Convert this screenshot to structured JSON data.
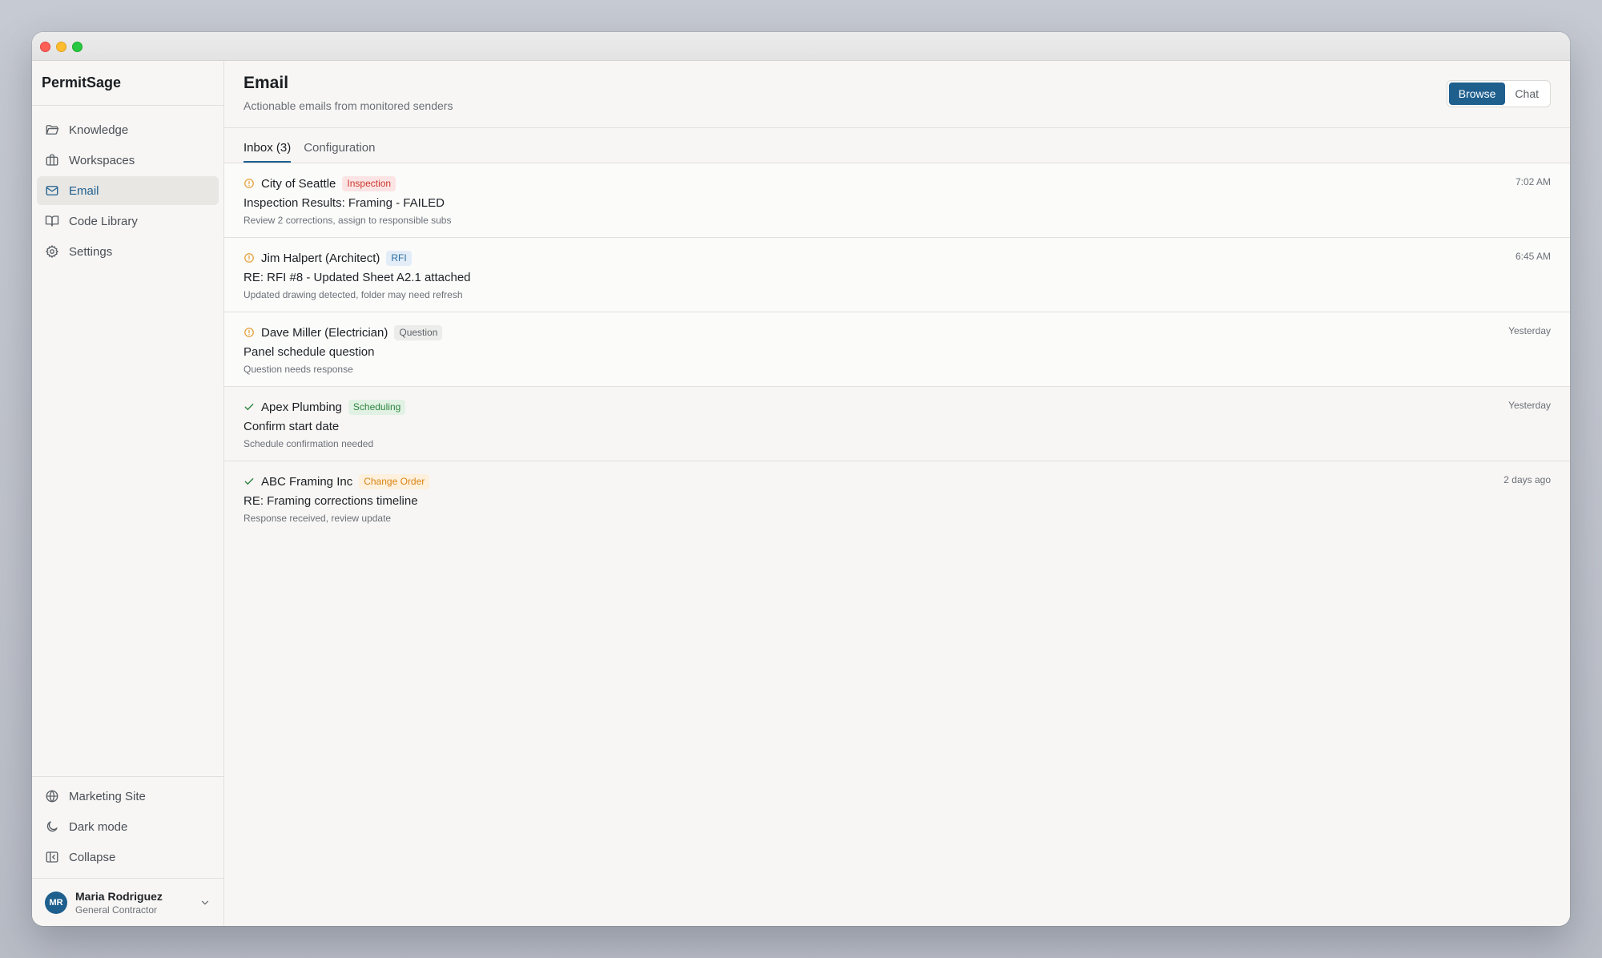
{
  "app": {
    "name": "PermitSage"
  },
  "sidebar": {
    "items": [
      {
        "label": "Knowledge",
        "icon": "folder-icon"
      },
      {
        "label": "Workspaces",
        "icon": "briefcase-icon"
      },
      {
        "label": "Email",
        "icon": "mail-icon",
        "active": true
      },
      {
        "label": "Code Library",
        "icon": "book-icon"
      },
      {
        "label": "Settings",
        "icon": "gear-icon"
      }
    ],
    "bottom_items": [
      {
        "label": "Marketing Site",
        "icon": "globe-icon"
      },
      {
        "label": "Dark mode",
        "icon": "moon-icon"
      },
      {
        "label": "Collapse",
        "icon": "collapse-icon"
      }
    ],
    "user": {
      "initials": "MR",
      "name": "Maria Rodriguez",
      "role": "General Contractor"
    }
  },
  "header": {
    "title": "Email",
    "subtitle": "Actionable emails from monitored senders",
    "view_toggle": {
      "browse": "Browse",
      "chat": "Chat",
      "selected": "Browse"
    }
  },
  "tabs": [
    {
      "label": "Inbox (3)",
      "active": true
    },
    {
      "label": "Configuration",
      "active": false
    }
  ],
  "emails": [
    {
      "sender": "City of Seattle",
      "tag": "Inspection",
      "tag_color": "#c8372d",
      "subject": "Inspection Results: Framing - FAILED",
      "summary": "Review 2 corrections, assign to responsible subs",
      "time": "7:02 AM",
      "status": "pending"
    },
    {
      "sender": "Jim Halpert (Architect)",
      "tag": "RFI",
      "tag_color": "#2d6ea3",
      "subject": "RE: RFI #8 - Updated Sheet A2.1 attached",
      "summary": "Updated drawing detected, folder may need refresh",
      "time": "6:45 AM",
      "status": "pending"
    },
    {
      "sender": "Dave Miller (Electrician)",
      "tag": "Question",
      "tag_color": "#5f646b",
      "subject": "Panel schedule question",
      "summary": "Question needs response",
      "time": "Yesterday",
      "status": "pending"
    },
    {
      "sender": "Apex Plumbing",
      "tag": "Scheduling",
      "tag_color": "#2e8540",
      "subject": "Confirm start date",
      "summary": "Schedule confirmation needed",
      "time": "Yesterday",
      "status": "done"
    },
    {
      "sender": "ABC Framing Inc",
      "tag": "Change Order",
      "tag_color": "#d98414",
      "subject": "RE: Framing corrections timeline",
      "summary": "Response received, review update",
      "time": "2 days ago",
      "status": "done"
    }
  ],
  "colors": {
    "accent": "#1e5f8e",
    "pending": "#e6a23c",
    "done": "#2e8540"
  }
}
